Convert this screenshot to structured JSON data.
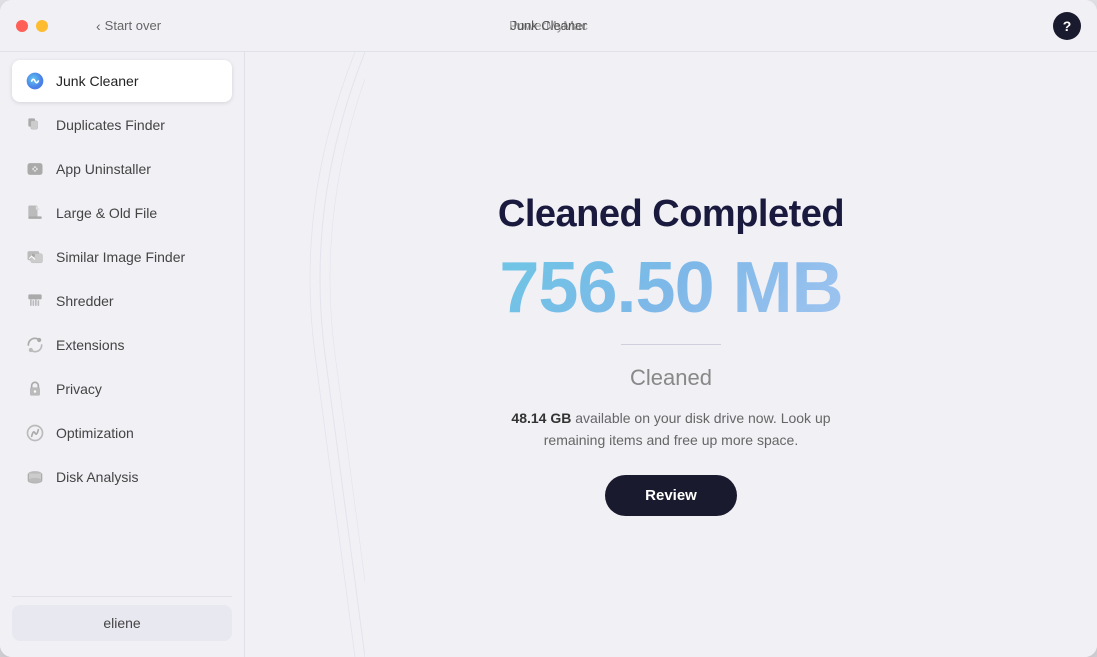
{
  "window": {
    "app_name": "PowerMyMac",
    "title": "Junk Cleaner"
  },
  "title_bar": {
    "back_label": "Start over",
    "help_label": "?"
  },
  "sidebar": {
    "items": [
      {
        "id": "junk-cleaner",
        "label": "Junk Cleaner",
        "active": true
      },
      {
        "id": "duplicates-finder",
        "label": "Duplicates Finder",
        "active": false
      },
      {
        "id": "app-uninstaller",
        "label": "App Uninstaller",
        "active": false
      },
      {
        "id": "large-old-file",
        "label": "Large & Old File",
        "active": false
      },
      {
        "id": "similar-image-finder",
        "label": "Similar Image Finder",
        "active": false
      },
      {
        "id": "shredder",
        "label": "Shredder",
        "active": false
      },
      {
        "id": "extensions",
        "label": "Extensions",
        "active": false
      },
      {
        "id": "privacy",
        "label": "Privacy",
        "active": false
      },
      {
        "id": "optimization",
        "label": "Optimization",
        "active": false
      },
      {
        "id": "disk-analysis",
        "label": "Disk Analysis",
        "active": false
      }
    ],
    "user": "eliene"
  },
  "content": {
    "title": "Cleaned Completed",
    "amount": "756.50 MB",
    "cleaned_label": "Cleaned",
    "disk_available": "48.14 GB",
    "disk_info": "available on your disk drive now. Look up remaining items and free up more space.",
    "review_button": "Review"
  }
}
